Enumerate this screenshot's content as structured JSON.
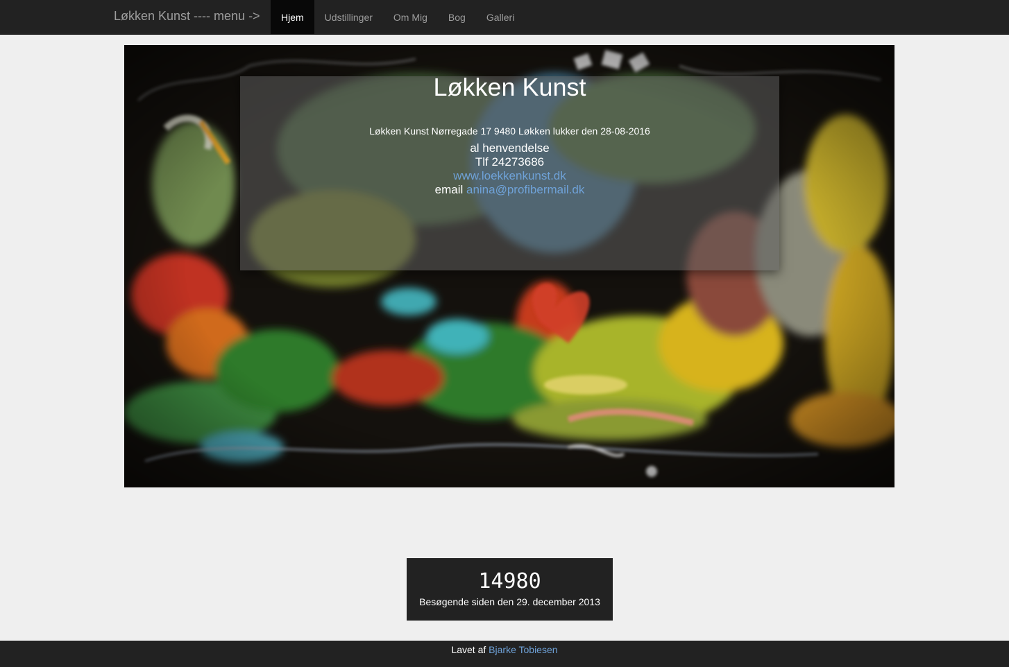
{
  "navbar": {
    "brand": "Løkken Kunst ---- menu ->",
    "items": [
      {
        "label": "Hjem",
        "active": true
      },
      {
        "label": "Udstillinger",
        "active": false
      },
      {
        "label": "Om Mig",
        "active": false
      },
      {
        "label": "Bog",
        "active": false
      },
      {
        "label": "Galleri",
        "active": false
      }
    ]
  },
  "hero": {
    "title": "Løkken Kunst",
    "address": "Løkken Kunst Nørregade 17 9480 Løkken lukker den 28-08-2016",
    "line1": "al henvendelse",
    "phone": "Tlf 24273686",
    "website": "www.loekkenkunst.dk",
    "email_label": "email",
    "email": "anina@profibermail.dk"
  },
  "counter": {
    "count": "14980",
    "label": "Besøgende siden den 29. december 2013"
  },
  "footer": {
    "prefix": "Lavet af",
    "author": "Bjarke Tobiesen"
  },
  "colors": {
    "navbar_bg": "#222222",
    "page_bg": "#efefef",
    "link": "#6fa2d8"
  }
}
